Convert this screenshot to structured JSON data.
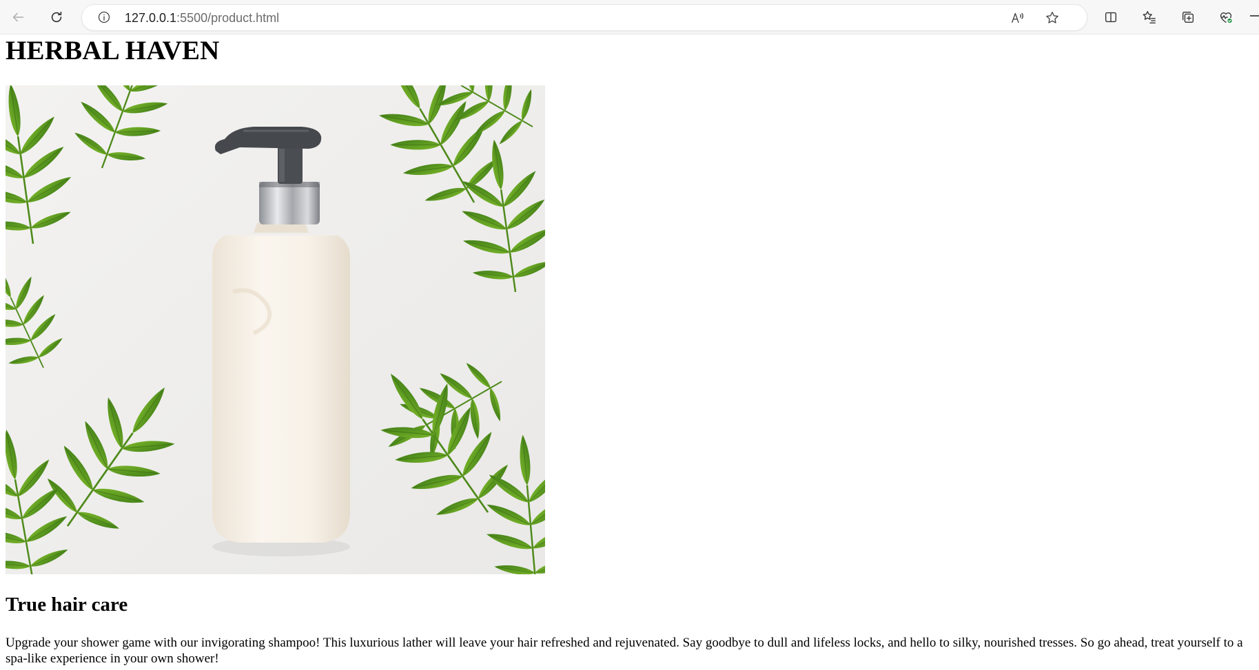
{
  "browser": {
    "url_host": "127.0.0.1",
    "url_rest": ":5500/product.html",
    "icons": {
      "back": "arrow-left-icon",
      "refresh": "refresh-icon",
      "site_info": "info-icon",
      "read_aloud": "read-aloud-icon",
      "favorite": "star-icon",
      "split_screen": "split-screen-icon",
      "favorites_list": "favorites-icon",
      "collections": "collections-icon",
      "browser_essentials": "heart-pulse-icon"
    }
  },
  "page": {
    "brand": "HERBAL HAVEN",
    "hero_image": "shampoo-bottle-with-leaves",
    "subtitle": "True hair care",
    "description": "Upgrade your shower game with our invigorating shampoo! This luxurious lather will leave your hair refreshed and rejuvenated. Say goodbye to dull and lifeless locks, and hello to silky, nourished tresses. So go ahead, treat yourself to a spa-like experience in your own shower!"
  },
  "colors": {
    "leaf_green": "#5f9e22",
    "leaf_dark": "#3f7a17",
    "bottle_cream": "#f6f0e7",
    "pump_gray": "#4a4d52",
    "essentials_badge": "#1a8f3c"
  }
}
